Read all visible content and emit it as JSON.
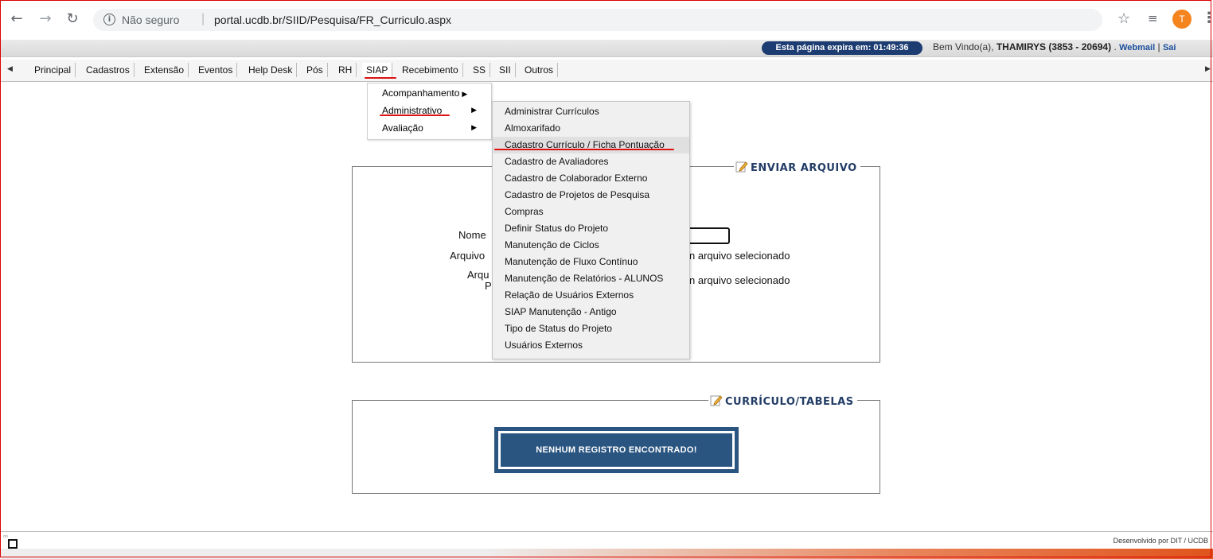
{
  "browser": {
    "not_secure": "Não seguro",
    "url": "portal.ucdb.br/SIID/Pesquisa/FR_Curriculo.aspx",
    "profile_initial": "T"
  },
  "header": {
    "expire_label": "Esta página expira em: 01:49:36",
    "welcome_prefix": "Bem Vindo(a), ",
    "user_name": "THAMIRYS (3853 - 20694)",
    "separator": " . ",
    "webmail": "Webmail",
    "pipe": " | ",
    "sair": "Sai"
  },
  "menu": {
    "items": [
      "Principal",
      "Cadastros",
      "Extensão",
      "Eventos",
      "Help Desk",
      "Pós",
      "RH",
      "SIAP",
      "Recebimento",
      "SS",
      "SII",
      "Outros"
    ]
  },
  "siap_menu": {
    "items": [
      "Acompanhamento",
      "Administrativo",
      "Avaliação"
    ]
  },
  "admin_menu": {
    "items": [
      "Administrar Currículos",
      "Almoxarifado",
      "Cadastro Currículo / Ficha Pontuação",
      "Cadastro de Avaliadores",
      "Cadastro de Colaborador Externo",
      "Cadastro de Projetos de Pesquisa",
      "Compras",
      "Definir Status do Projeto",
      "Manutenção de Ciclos",
      "Manutenção de Fluxo Contínuo",
      "Manutenção de Relatórios - ALUNOS",
      "Relação de Usuários Externos",
      "SIAP Manutenção - Antigo",
      "Tipo de Status do Projeto",
      "Usuários Externos"
    ]
  },
  "upload_box": {
    "title": "ENVIAR ARQUIVO",
    "label_nome": "Nome",
    "label_arquivo": "Arquivo",
    "label_arq": "Arqu",
    "label_p": "P",
    "file_status_1": "n arquivo selecionado",
    "file_status_2": "n arquivo selecionado"
  },
  "tables_box": {
    "title": "CURRÍCULO/TABELAS",
    "no_records": "NENHUM REGISTRO ENCONTRADO!"
  },
  "footer": {
    "credit": "Desenvolvido por DIT / UCDB"
  },
  "colors": {
    "badge": "#1c3c72",
    "title": "#233d66",
    "button": "#2a5580",
    "highlight_underline": "#dd1111"
  }
}
